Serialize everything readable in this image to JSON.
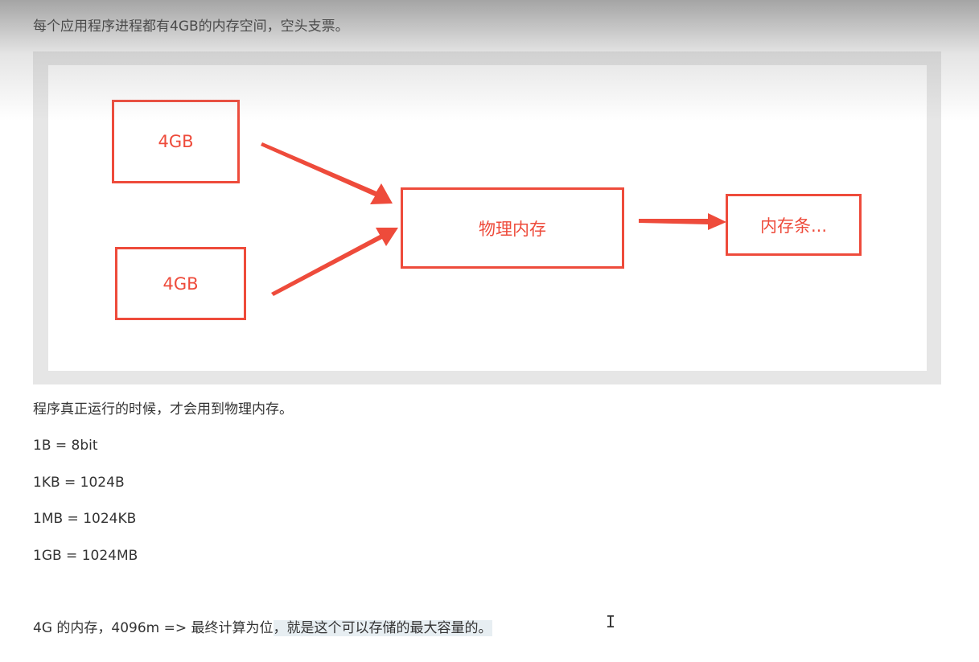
{
  "intro": "每个应用程序进程都有4GB的内存空间，空头支票。",
  "diagram": {
    "box_a": "4GB",
    "box_b": "4GB",
    "physical_memory": "物理内存",
    "memory_stick": "内存条...",
    "accent_color": "#ee4b3b"
  },
  "paragraphs": {
    "runtime": "程序真正运行的时候，才会用到物理内存。",
    "byte": "1B = 8bit",
    "kb": "1KB = 1024B",
    "mb": "1MB = 1024KB",
    "gb": "1GB = 1024MB",
    "last_prefix": "4G 的内存，4096m => 最终计算为位",
    "last_highlighted": "，就是这个可以存储的最大容量的。"
  },
  "cursor_glyph": "I"
}
